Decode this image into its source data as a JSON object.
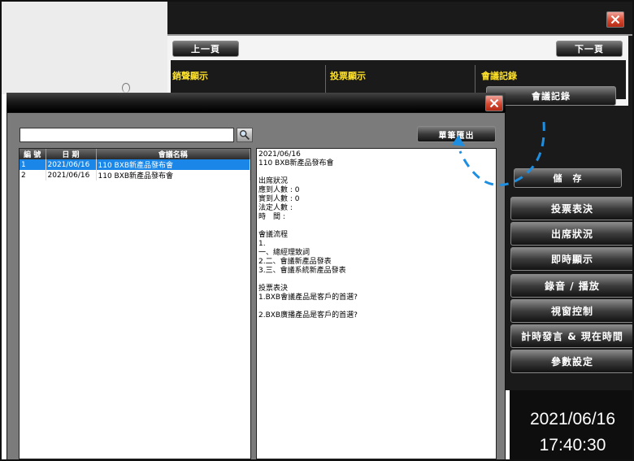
{
  "top_window": {
    "prev_button": "上一頁",
    "next_button": "下一頁",
    "labels": [
      "銷聲顯示",
      "投票顯示",
      "會議記錄"
    ],
    "meeting_record_button": "會議記錄",
    "save_button": "儲　存"
  },
  "dialog": {
    "search": {
      "value": "",
      "placeholder": ""
    },
    "export_button": "單筆匯出",
    "list": {
      "headers": [
        "編 號",
        "日 期",
        "會議名稱"
      ],
      "rows": [
        {
          "id": "1",
          "date": "2021/06/16",
          "name": "110 BXB新產品發布會",
          "selected": true
        },
        {
          "id": "2",
          "date": "2021/06/16",
          "name": "110 BXB新產品發布會",
          "selected": false
        }
      ]
    },
    "detail_lines": [
      "2021/06/16",
      "110 BXB新產品發布會",
      "",
      "出席狀況",
      "應到人數 : 0",
      "實到人數 : 0",
      "法定人數 :",
      "時　間 :",
      "",
      "會議流程",
      "1.",
      "一、總經理致詞",
      "2.二、會議新產品發表",
      "3.三、會議系統新產品發表",
      "",
      "投票表決",
      "1.BXB會議產品是客戶的首選?",
      "",
      "2.BXB廣播產品是客戶的首選?"
    ]
  },
  "side_menu": [
    "投票表決",
    "出席狀況",
    "即時顯示",
    "錄音 / 播放",
    "視窗控制",
    "計時發言 & 現在時間",
    "參數設定"
  ],
  "clock": {
    "date": "2021/06/16",
    "time": "17:40:30"
  },
  "colors": {
    "selection": "#1a86e8",
    "label_yellow": "#ffe22a",
    "annotation_blue": "#1e8fe0"
  },
  "icons": [
    "close-icon",
    "search-icon"
  ]
}
